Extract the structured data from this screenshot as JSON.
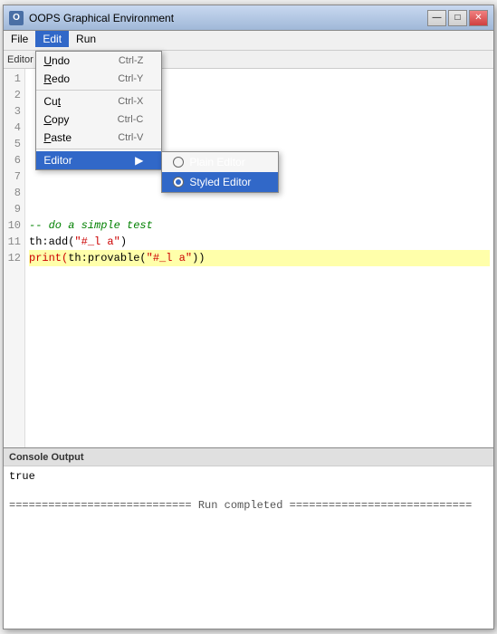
{
  "window": {
    "title": "OOPS Graphical Environment",
    "icon": "O"
  },
  "titlebar_buttons": {
    "minimize": "—",
    "maximize": "□",
    "close": "✕"
  },
  "menubar": {
    "items": [
      {
        "id": "file",
        "label": "File"
      },
      {
        "id": "edit",
        "label": "Edit",
        "active": true
      },
      {
        "id": "run",
        "label": "Run"
      }
    ]
  },
  "edit_menu": {
    "items": [
      {
        "id": "undo",
        "label": "Undo",
        "shortcut": "Ctrl-Z",
        "underline_start": 0,
        "underline_end": 1
      },
      {
        "id": "redo",
        "label": "Redo",
        "shortcut": "Ctrl-Y"
      },
      {
        "id": "separator1"
      },
      {
        "id": "cut",
        "label": "Cut",
        "shortcut": "Ctrl-X"
      },
      {
        "id": "copy",
        "label": "Copy",
        "shortcut": "Ctrl-C"
      },
      {
        "id": "paste",
        "label": "Paste",
        "shortcut": "Ctrl-V"
      },
      {
        "id": "separator2"
      },
      {
        "id": "editor",
        "label": "Editor",
        "hasSubmenu": true
      }
    ]
  },
  "editor_submenu": {
    "items": [
      {
        "id": "plain",
        "label": "Plain Editor",
        "selected": false
      },
      {
        "id": "styled",
        "label": "Styled Editor",
        "selected": true
      }
    ]
  },
  "editor_label": "Editor",
  "code_lines": [
    {
      "num": "1",
      "content": "",
      "type": "normal"
    },
    {
      "num": "2",
      "content": "",
      "type": "normal"
    },
    {
      "num": "3",
      "content": "",
      "type": "normal"
    },
    {
      "num": "4",
      "content": "",
      "type": "normal"
    },
    {
      "num": "5",
      "content": "",
      "type": "normal"
    },
    {
      "num": "6",
      "content": "",
      "type": "normal"
    },
    {
      "num": "7",
      "content": "",
      "type": "normal"
    },
    {
      "num": "8",
      "content": "",
      "type": "normal"
    },
    {
      "num": "9",
      "content": "",
      "type": "normal"
    },
    {
      "num": "10",
      "content": "-- do a simple test",
      "type": "comment"
    },
    {
      "num": "11",
      "content": "th:add(\"#_l a\")",
      "type": "normal"
    },
    {
      "num": "12",
      "content": "print(th:provable(\"#_l a\"))",
      "type": "highlighted"
    }
  ],
  "console": {
    "header": "Console Output",
    "output_lines": [
      "true",
      "",
      "============================  Run completed  ============================"
    ]
  }
}
